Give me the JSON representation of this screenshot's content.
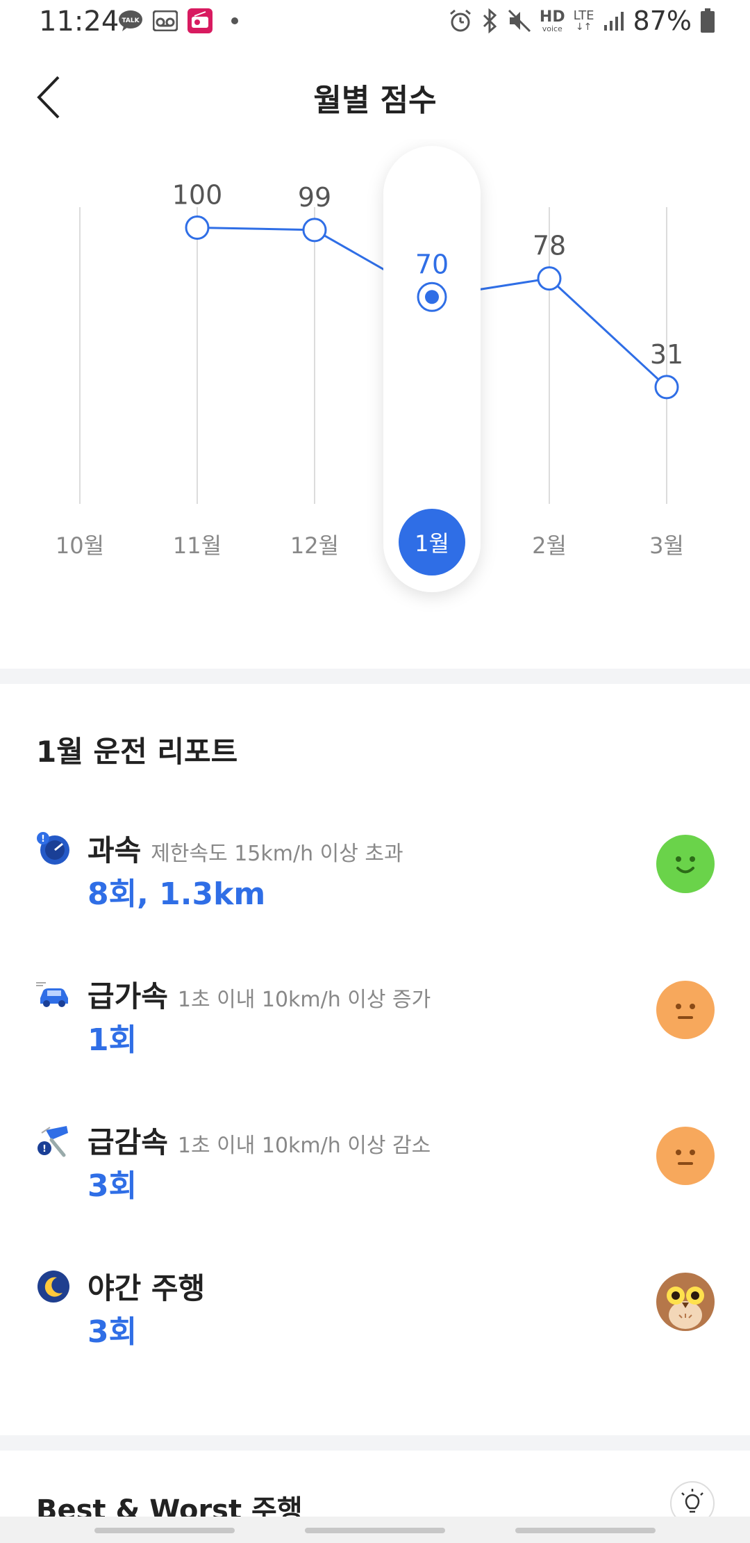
{
  "status_bar": {
    "time": "11:24",
    "notification_icons": [
      "talk-icon",
      "voicemail-icon",
      "radio-icon",
      "dot-icon"
    ],
    "system_icons": [
      "alarm-icon",
      "bluetooth-icon",
      "mute-icon",
      "hd-voice-icon",
      "lte-icon",
      "signal-icon"
    ],
    "hd_label": "HD",
    "voice_label": "voice",
    "lte_label": "LTE",
    "battery": "87%"
  },
  "header": {
    "back_icon": "chevron-left-icon",
    "title": "월별 점수"
  },
  "chart_data": {
    "type": "line",
    "categories": [
      "10월",
      "11월",
      "12월",
      "1월",
      "2월",
      "3월"
    ],
    "values": [
      null,
      100,
      99,
      70,
      78,
      31
    ],
    "value_labels": [
      "",
      "100",
      "99",
      "70",
      "78",
      "31"
    ],
    "selected_index": 3,
    "colors": {
      "line": "#2f6ee6",
      "selected": "#2f6ee6",
      "grid": "#dcdcdc",
      "label": "#555555",
      "selected_label": "#2f6ee6"
    }
  },
  "report": {
    "title": "1월 운전 리포트",
    "items": [
      {
        "icon": "speedometer-icon",
        "name": "과속",
        "desc": "제한속도 15km/h 이상 초과",
        "count": "8회, 1.3km",
        "face": "happy-face-icon",
        "face_color": "#6ad34a"
      },
      {
        "icon": "car-accelerate-icon",
        "name": "급가속",
        "desc": "1초 이내 10km/h 이상 증가",
        "count": "1회",
        "face": "neutral-face-icon",
        "face_color": "#f7a85c"
      },
      {
        "icon": "brake-icon",
        "name": "급감속",
        "desc": "1초 이내 10km/h 이상 감소",
        "count": "3회",
        "face": "neutral-face-icon",
        "face_color": "#f7a85c"
      },
      {
        "icon": "moon-icon",
        "name": "야간 주행",
        "desc": "",
        "count": "3회",
        "face": "owl-icon",
        "face_color": "#b5774a"
      }
    ]
  },
  "best_worst": {
    "title": "Best & Worst 주행",
    "icon": "lightbulb-icon"
  }
}
